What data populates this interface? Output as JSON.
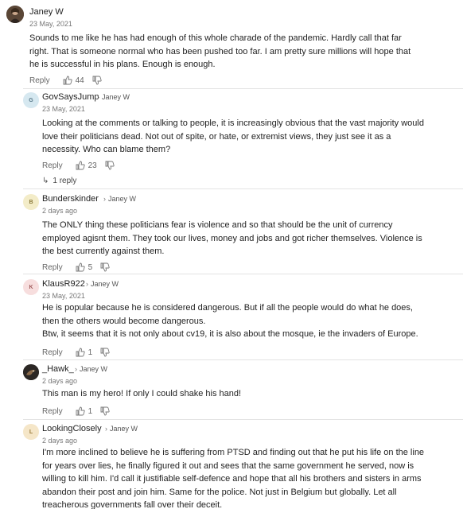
{
  "colors": {
    "page_bg": "#ffffff",
    "text": "#222222",
    "muted": "#777777",
    "avatar_g": "#d6e8f0",
    "avatar_b": "#f3ecc8",
    "avatar_k": "#f7dede",
    "avatar_l": "#f5e6c8"
  },
  "comments": [
    {
      "author": "Janey W",
      "reply_to": "",
      "avatar_icon": "user-photo-icon",
      "date": "23 May, 2021",
      "lines": [
        "Sounds to me like he has had enough of this whole charade of the pandemic. Hardly call that far",
        "right. That is someone normal who has been pushed too far.  I am pretty sure millions will hope that",
        "he is successful in his plans. Enough is enough."
      ],
      "reply_label": "Reply",
      "likes": "44"
    },
    {
      "author": "GovSaysJump",
      "reply_to": "Janey W",
      "avatar_letter": "G",
      "date": "23 May, 2021",
      "lines": [
        "Looking at the comments or talking to people, it is increasingly obvious that the vast majority would",
        "love their politicians dead. Not out of spite, or hate, or extremist views, they just see it as a",
        "necessity. Who can blame them?"
      ],
      "reply_label": "Reply",
      "likes": "23",
      "replies_label": "1 reply"
    },
    {
      "author": "Bunderskinder",
      "reply_to": "Janey W",
      "avatar_letter": "B",
      "date": "2 days ago",
      "lines": [
        "The ONLY thing these politicians fear is violence and so that should be the unit of currency",
        "employed agisnt them. They took our lives, money and jobs and got richer themselves. Violence is",
        "the best currently against them."
      ],
      "reply_label": "Reply",
      "likes": "5"
    },
    {
      "author": "KlausR922",
      "reply_to": "Janey W",
      "avatar_letter": "K",
      "date": "23 May, 2021",
      "lines": [
        "He is popular because he is considered dangerous. But if all the people would do what he does,",
        "then the others would become dangerous.",
        "Btw, it seems that it is not only about cv19, it is also about the mosque, ie the invaders of Europe."
      ],
      "reply_label": "Reply",
      "likes": "1"
    },
    {
      "author": "_Hawk_",
      "reply_to": "Janey W",
      "avatar_icon": "hawk-photo-icon",
      "date": "2 days ago",
      "lines": [
        "This man is my hero!  If only I could shake his hand!"
      ],
      "reply_label": "Reply",
      "likes": "1"
    },
    {
      "author": "LookingClosely",
      "reply_to": "Janey W",
      "avatar_letter": "L",
      "date": "2 days ago",
      "lines": [
        "I'm more inclined to believe he is suffering from PTSD and finding out that he put his life on the line",
        "for years over lies, he finally figured it out and sees that the same government he served, now is",
        "willing to kill him. I'd call it justifiable self-defence and hope that all his brothers and sisters in arms",
        "abandon their post and join him. Same for the police. Not just in Belgium but globally. Let all",
        "treacherous governments fall over their deceit."
      ]
    }
  ]
}
